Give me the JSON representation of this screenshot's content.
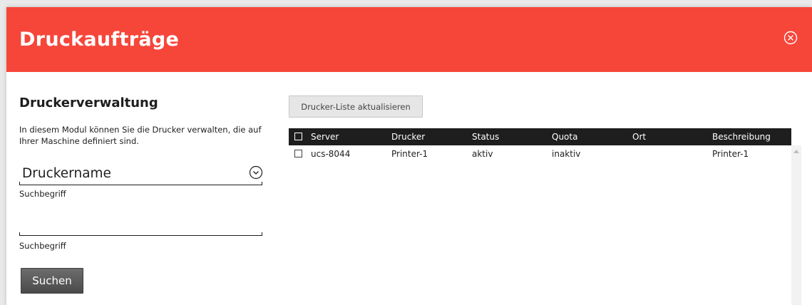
{
  "header": {
    "title": "Druckaufträge",
    "color": "#f6463a"
  },
  "left_panel": {
    "title": "Druckerverwaltung",
    "description": "In diesem Modul können Sie die Drucker verwalten, die auf Ihrer Maschine definiert sind.",
    "category_select": {
      "value": "Druckername"
    },
    "category_label": "Suchbegriff",
    "search_input": {
      "value": "",
      "placeholder": ""
    },
    "search_label": "Suchbegriff",
    "search_button": "Suchen"
  },
  "right_panel": {
    "refresh_button": "Drucker-Liste aktualisieren",
    "columns": [
      "Server",
      "Drucker",
      "Status",
      "Quota",
      "Ort",
      "Beschreibung"
    ],
    "rows": [
      {
        "checked": false,
        "server": "ucs-8044",
        "drucker": "Printer-1",
        "status": "aktiv",
        "quota": "inaktiv",
        "ort": "",
        "beschreibung": "Printer-1"
      }
    ]
  },
  "icons": {
    "close": "close-circle-icon",
    "dropdown": "chevron-down-circle-icon",
    "scroll_up": "scroll-up-arrow-icon"
  }
}
